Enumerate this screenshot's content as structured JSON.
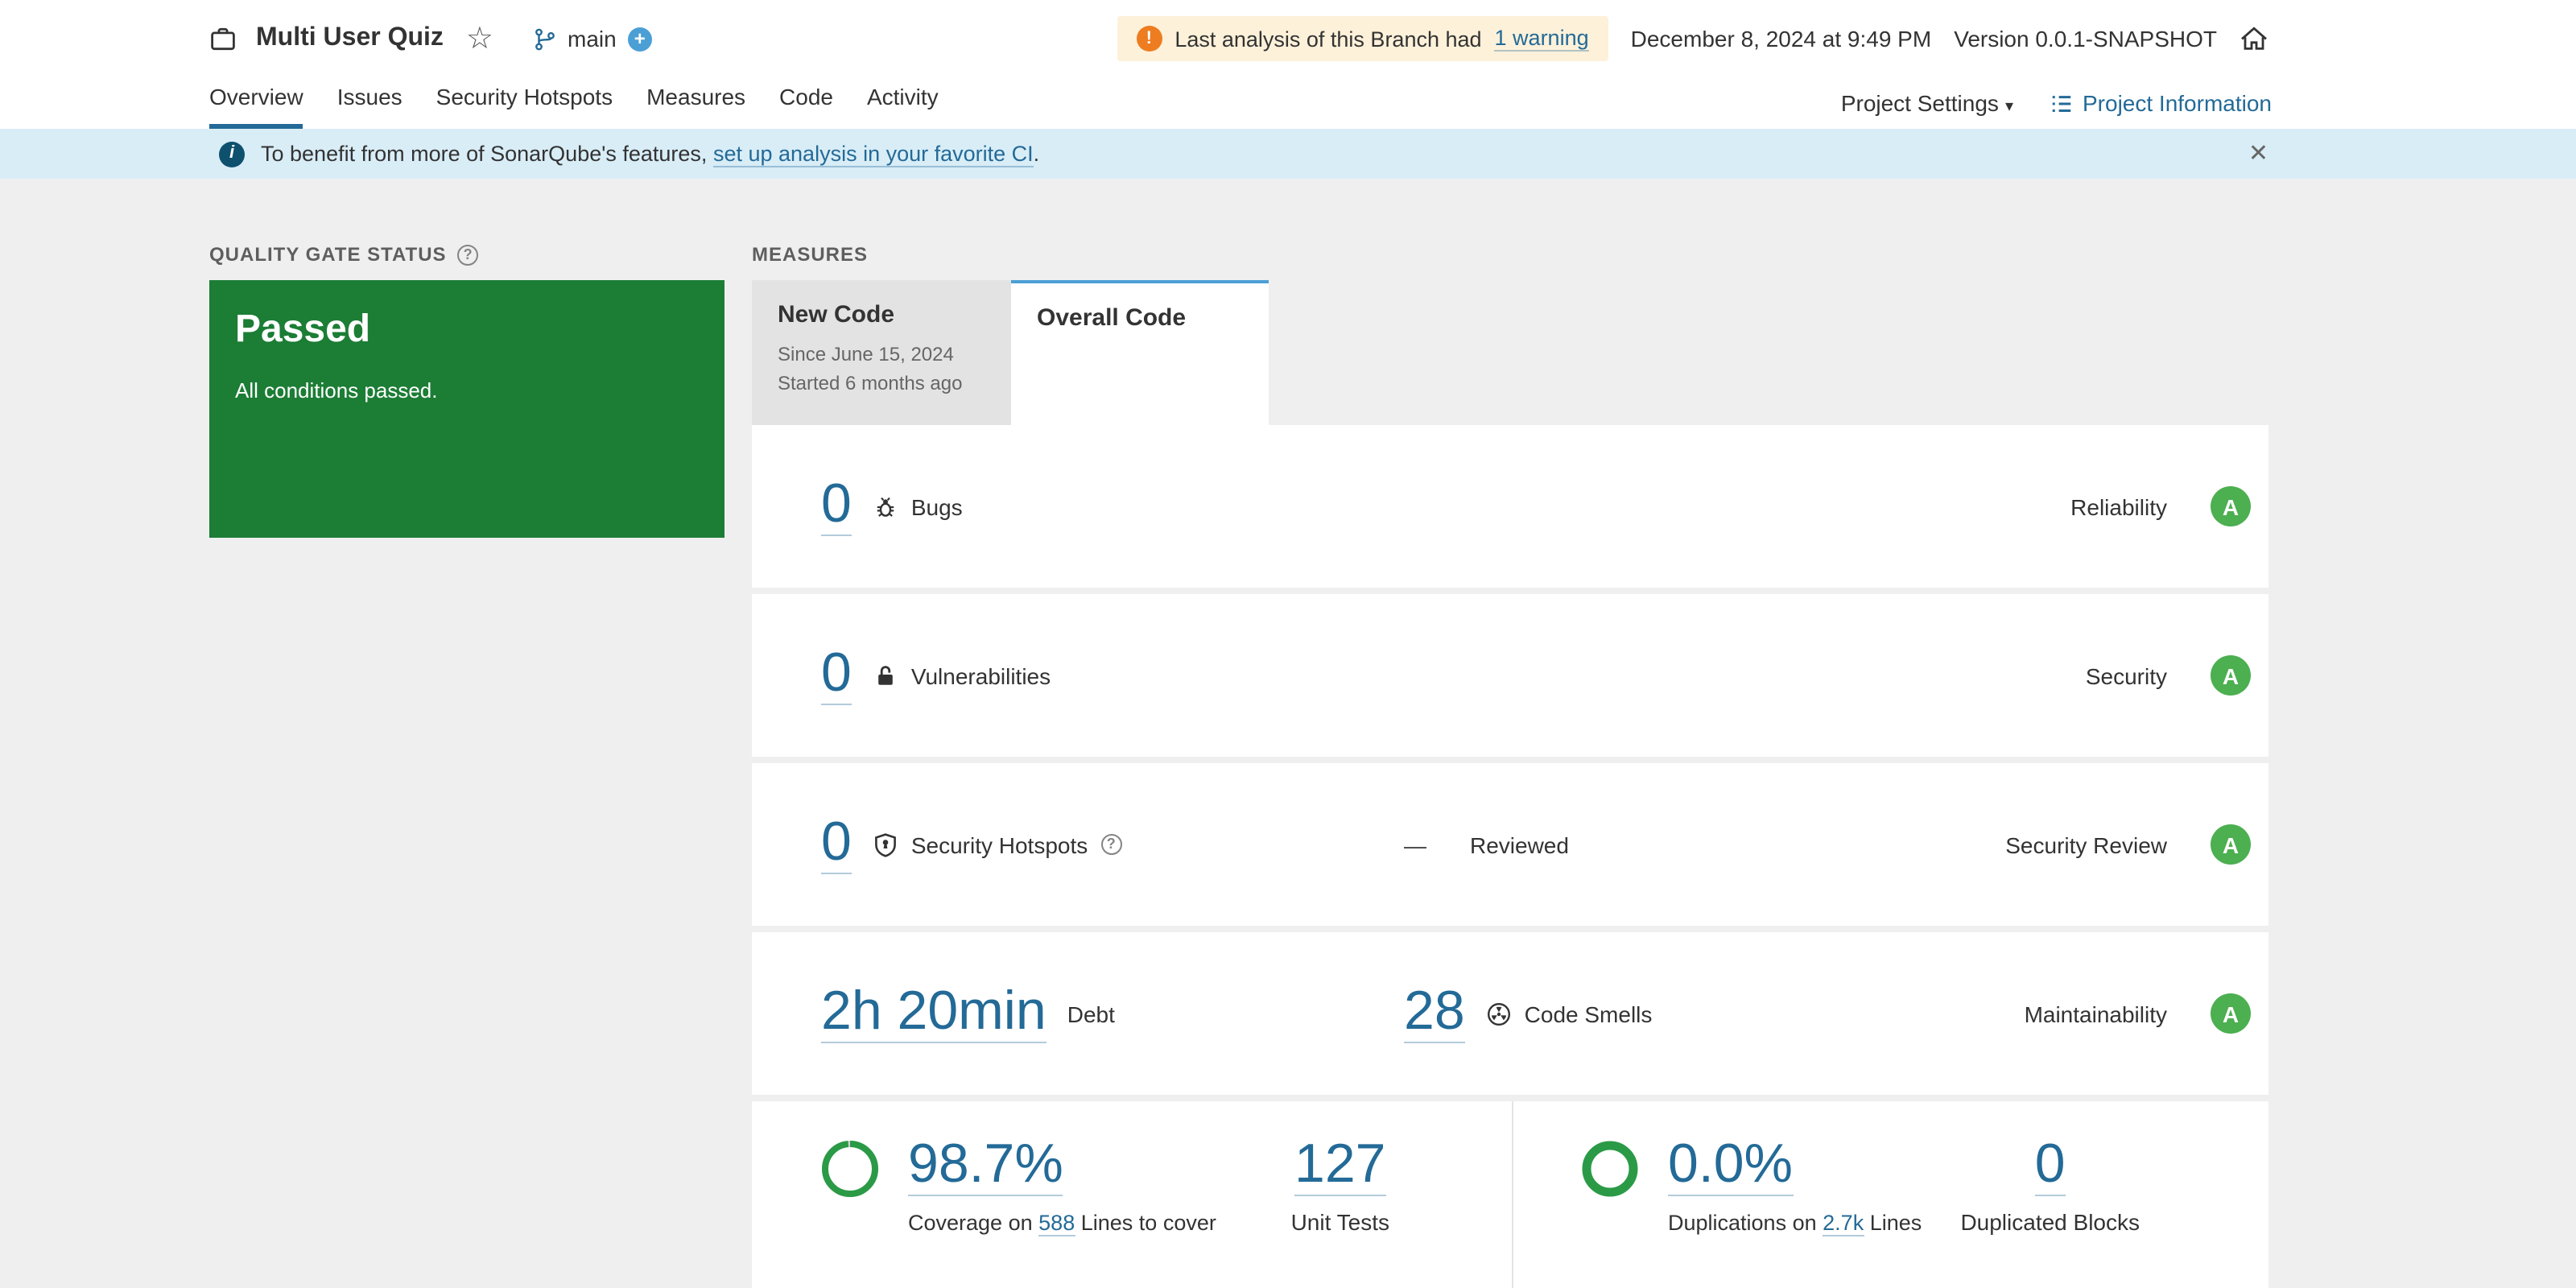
{
  "header": {
    "title": "Multi User Quiz",
    "branch": "main",
    "warning_prefix": "Last analysis of this Branch had",
    "warning_link": "1 warning",
    "date": "December 8, 2024 at 9:49 PM",
    "version": "Version 0.0.1-SNAPSHOT"
  },
  "nav": {
    "tabs": [
      {
        "label": "Overview",
        "active": true
      },
      {
        "label": "Issues",
        "active": false
      },
      {
        "label": "Security Hotspots",
        "active": false
      },
      {
        "label": "Measures",
        "active": false
      },
      {
        "label": "Code",
        "active": false
      },
      {
        "label": "Activity",
        "active": false
      }
    ],
    "settings_label": "Project Settings",
    "info_label": "Project Information"
  },
  "banner": {
    "prefix": "To benefit from more of SonarQube's features,",
    "link": "set up analysis in your favorite CI",
    "suffix": "."
  },
  "quality_gate": {
    "heading": "QUALITY GATE STATUS",
    "status": "Passed",
    "description": "All conditions passed."
  },
  "measures": {
    "heading": "MEASURES",
    "new_code": {
      "label": "New Code",
      "since": "Since June 15, 2024",
      "started": "Started 6 months ago"
    },
    "overall_code": {
      "label": "Overall Code"
    },
    "rows": {
      "bugs": {
        "value": "0",
        "label": "Bugs",
        "domain": "Reliability",
        "rating": "A"
      },
      "vulnerabilities": {
        "value": "0",
        "label": "Vulnerabilities",
        "domain": "Security",
        "rating": "A"
      },
      "hotspots": {
        "value": "0",
        "label": "Security Hotspots",
        "reviewed_value": "—",
        "reviewed_label": "Reviewed",
        "domain": "Security Review",
        "rating": "A"
      },
      "maintainability": {
        "debt_value": "2h 20min",
        "debt_label": "Debt",
        "smells_value": "28",
        "smells_label": "Code Smells",
        "domain": "Maintainability",
        "rating": "A"
      },
      "coverage": {
        "value": "98.7%",
        "caption_prefix": "Coverage on",
        "lines_link": "588",
        "caption_suffix": "Lines to cover",
        "tests_value": "127",
        "tests_label": "Unit Tests"
      },
      "duplications": {
        "value": "0.0%",
        "caption_prefix": "Duplications on",
        "lines_link": "2.7k",
        "caption_suffix": "Lines",
        "blocks_value": "0",
        "blocks_label": "Duplicated Blocks"
      }
    }
  },
  "icons": {
    "star": "☆",
    "plus": "+",
    "warning": "!",
    "info": "i",
    "help": "?",
    "close": "✕",
    "caret": "▾"
  },
  "colors": {
    "link_blue": "#236a97",
    "light_blue": "#4b9fd5",
    "passed_green": "#1c7d35",
    "rating_a_green": "#4caf50",
    "ring_green": "#2b9a46",
    "warning_orange": "#ed7d20",
    "warning_bg": "#fdf1da",
    "banner_bg": "#d9edf7",
    "page_bg": "#efefef"
  }
}
